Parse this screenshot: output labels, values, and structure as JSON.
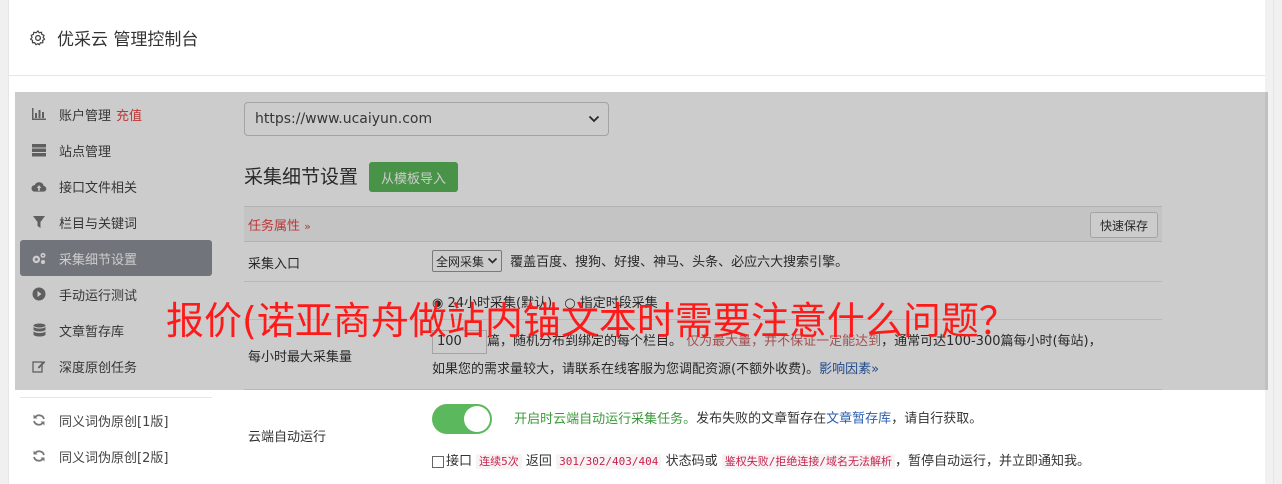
{
  "header": {
    "title": "优采云 管理控制台"
  },
  "sidebar": {
    "items": [
      {
        "label": "账户管理",
        "extra": "充值",
        "icon": "bar-chart-icon"
      },
      {
        "label": "站点管理",
        "icon": "server-icon"
      },
      {
        "label": "接口文件相关",
        "icon": "cloud-upload-icon"
      },
      {
        "label": "栏目与关键词",
        "icon": "filter-icon"
      },
      {
        "label": "采集细节设置",
        "icon": "gears-icon",
        "active": true
      },
      {
        "label": "手动运行测试",
        "icon": "play-icon"
      },
      {
        "label": "文章暂存库",
        "icon": "database-icon"
      },
      {
        "label": "深度原创任务",
        "icon": "edit-icon"
      },
      {
        "label": "同义词伪原创[1版]",
        "icon": "refresh-icon"
      },
      {
        "label": "同义词伪原创[2版]",
        "icon": "refresh-icon"
      }
    ]
  },
  "main": {
    "site_select": "https://www.ucaiyun.com",
    "section_title": "采集细节设置",
    "import_button": "从模板导入",
    "task_props_label": "任务属性",
    "quick_save": "快速保存",
    "rows": {
      "entry_label": "采集入口",
      "entry_select": "全网采集",
      "entry_desc": "覆盖百度、搜狗、好搜、神马、头条、必应六大搜索引擎。",
      "mode_radio1": "24小时采集(默认)",
      "mode_radio2": "指定时段采集",
      "max_label": "每小时最大采集量",
      "max_value": "100",
      "max_desc1": "篇，随机分布到绑定的每个栏目。",
      "max_desc_red": "仅为最大量，并不保证一定能达到",
      "max_desc2": "，通常可达100-300篇每小时(每站)，",
      "max_desc3": "如果您的需求量较大，请联系在线客服为您调配资源(不额外收费)。",
      "max_link": "影响因素",
      "cloud_label": "云端自动运行",
      "cloud_green": "开启时云端自动运行采集任务。",
      "cloud_text": "发布失败的文章暂存在",
      "cloud_link": "文章暂存库",
      "cloud_text2": "，请自行获取。",
      "api_text1": "接口",
      "api_code1": "连续5次",
      "api_text2": "返回",
      "api_code2": "301/302/403/404",
      "api_text3": "状态码或",
      "api_code3": "鉴权失败/拒绝连接/域名无法解析",
      "api_text4": "，暂停自动运行，并立即通知我。"
    }
  },
  "watermark": "报价(诺亚商舟做站内锚文本时需要注意什么问题？",
  "colors": {
    "accent_green": "#5cb85c",
    "active_bg": "#8e929a",
    "red": "#e44"
  }
}
